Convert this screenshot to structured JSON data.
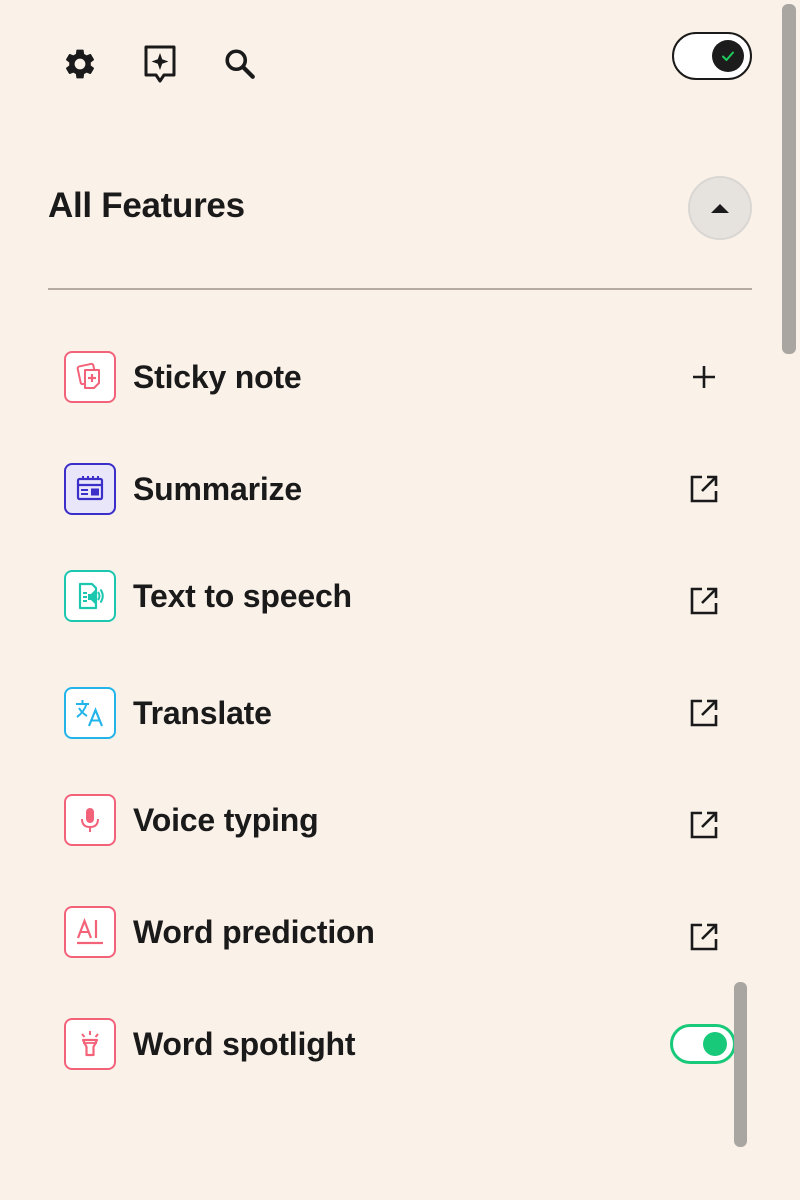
{
  "toolbar": {
    "icons": [
      "gear-icon",
      "sparkle-bookmark-icon",
      "search-icon"
    ],
    "master_toggle_on": true
  },
  "section": {
    "title": "All Features",
    "collapsed": false
  },
  "features": [
    {
      "label": "Sticky note",
      "icon": "sticky-note-plus-icon",
      "color": "#F2637A",
      "fill": "#FFFFFF",
      "action": "add"
    },
    {
      "label": "Summarize",
      "icon": "summarize-icon",
      "color": "#3B2EC9",
      "fill": "#E9E6FA",
      "action": "open-external"
    },
    {
      "label": "Text to speech",
      "icon": "text-to-speech-icon",
      "color": "#1CC7B0",
      "fill": "#FFFFFF",
      "action": "open-external"
    },
    {
      "label": "Translate",
      "icon": "translate-icon",
      "color": "#23B5EA",
      "fill": "#FFFFFF",
      "action": "open-external"
    },
    {
      "label": "Voice typing",
      "icon": "microphone-icon",
      "color": "#F2637A",
      "fill": "#FFFFFF",
      "action": "open-external"
    },
    {
      "label": "Word prediction",
      "icon": "word-prediction-icon",
      "color": "#F2637A",
      "fill": "#FFFFFF",
      "action": "open-external"
    },
    {
      "label": "Word spotlight",
      "icon": "spotlight-icon",
      "color": "#F2637A",
      "fill": "#FFFFFF",
      "action": "toggle",
      "enabled": true
    }
  ],
  "colors": {
    "background": "#FAF1E9",
    "accent_green": "#18C97A",
    "text": "#1A1A1A"
  }
}
